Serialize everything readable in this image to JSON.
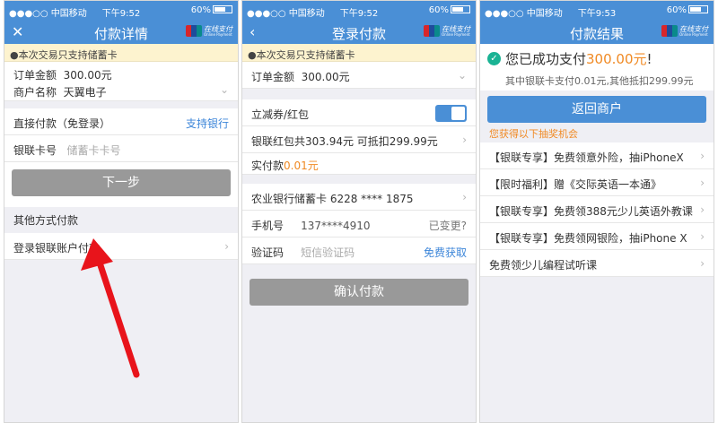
{
  "status": {
    "signal": "●●●○○ 中国移动 ",
    "battery": "60%"
  },
  "screens": [
    {
      "time": "下午9:52",
      "title": "付款详情",
      "nav_icon": "close-icon",
      "logo": {
        "text": "在线支付",
        "sub": "Online Payment"
      },
      "notice": "●本次交易只支持储蓄卡",
      "order_amount_label": "订单金额",
      "order_amount": "300.00元",
      "merchant_label": "商户名称",
      "merchant": "天翼电子",
      "direct_pay_label": "直接付款（免登录）",
      "support_bank_link": "支持银行",
      "card_label": "银联卡号",
      "card_placeholder": "储蓄卡卡号",
      "next_button": "下一步",
      "other_methods_label": "其他方式付款",
      "login_pay_label": "登录银联账户付款"
    },
    {
      "time": "下午9:52",
      "title": "登录付款",
      "nav_icon": "back-icon",
      "logo": {
        "text": "在线支付",
        "sub": "Online Payment"
      },
      "notice": "●本次交易只支持储蓄卡",
      "order_amount_label": "订单金额",
      "order_amount": "300.00元",
      "coupon_label": "立减券/红包",
      "redpacket_label": "银联红包共303.94元 可抵扣299.99元",
      "actual_pay_label": "实付款",
      "actual_pay_amount": "0.01元",
      "bank_card": "农业银行储蓄卡 6228 **** 1875",
      "phone_label": "手机号",
      "phone_value": "137****4910",
      "phone_change": "已变更?",
      "code_label": "验证码",
      "code_placeholder": "短信验证码",
      "code_get": "免费获取",
      "confirm_button": "确认付款"
    },
    {
      "time": "下午9:53",
      "title": "付款结果",
      "logo": {
        "text": "在线支付",
        "sub": "Online Payment"
      },
      "success_prefix": "您已成功支付",
      "success_amount": "300.00元",
      "success_suffix": "!",
      "success_detail": "其中银联卡支付0.01元,其他抵扣299.99元",
      "return_button": "返回商户",
      "lottery_label": "您获得以下抽奖机会",
      "offers": [
        "【银联专享】免费领意外险，抽iPhoneX",
        "【限时福利】赠《交际英语一本通》",
        "【银联专享】免费领388元少儿英语外教课",
        "【银联专享】免费领网银险，抽iPhone X",
        "免费领少儿编程试听课"
      ]
    }
  ],
  "colors": {
    "nav": "#4a8fd6",
    "notice_bg": "#fdf3cf",
    "accent_orange": "#f08a24",
    "link_blue": "#3d86d9",
    "disabled_button": "#999999",
    "arrow": "#e8141b"
  }
}
